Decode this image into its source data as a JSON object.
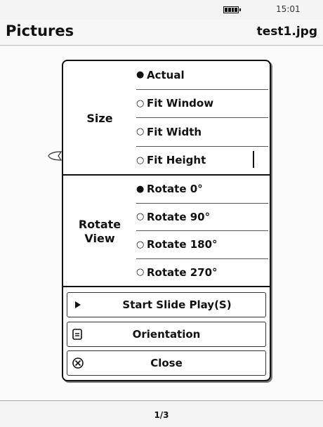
{
  "status_bar": {
    "time": "15:01",
    "battery_icon": "battery-full-icon"
  },
  "header": {
    "title": "Pictures",
    "file_name": "test1.jpg"
  },
  "menu": {
    "size_section": {
      "label": "Size",
      "options": [
        {
          "label": "Actual",
          "selected": true
        },
        {
          "label": "Fit Window",
          "selected": false
        },
        {
          "label": "Fit Width",
          "selected": false
        },
        {
          "label": "Fit Height",
          "selected": false
        }
      ]
    },
    "rotate_section": {
      "label": "Rotate View",
      "options": [
        {
          "label": "Rotate 0°",
          "selected": true
        },
        {
          "label": "Rotate 90°",
          "selected": false
        },
        {
          "label": "Rotate 180°",
          "selected": false
        },
        {
          "label": "Rotate 270°",
          "selected": false
        }
      ]
    },
    "actions": [
      {
        "label": "Start Slide Play(S)",
        "icon": "play-icon"
      },
      {
        "label": "Orientation",
        "icon": "orientation-icon"
      },
      {
        "label": "Close",
        "icon": "close-circle-icon"
      }
    ]
  },
  "footer": {
    "page_indicator": "1/3"
  },
  "colors": {
    "border": "#111111",
    "background": "#fafafa",
    "menu_background": "#ffffff"
  }
}
